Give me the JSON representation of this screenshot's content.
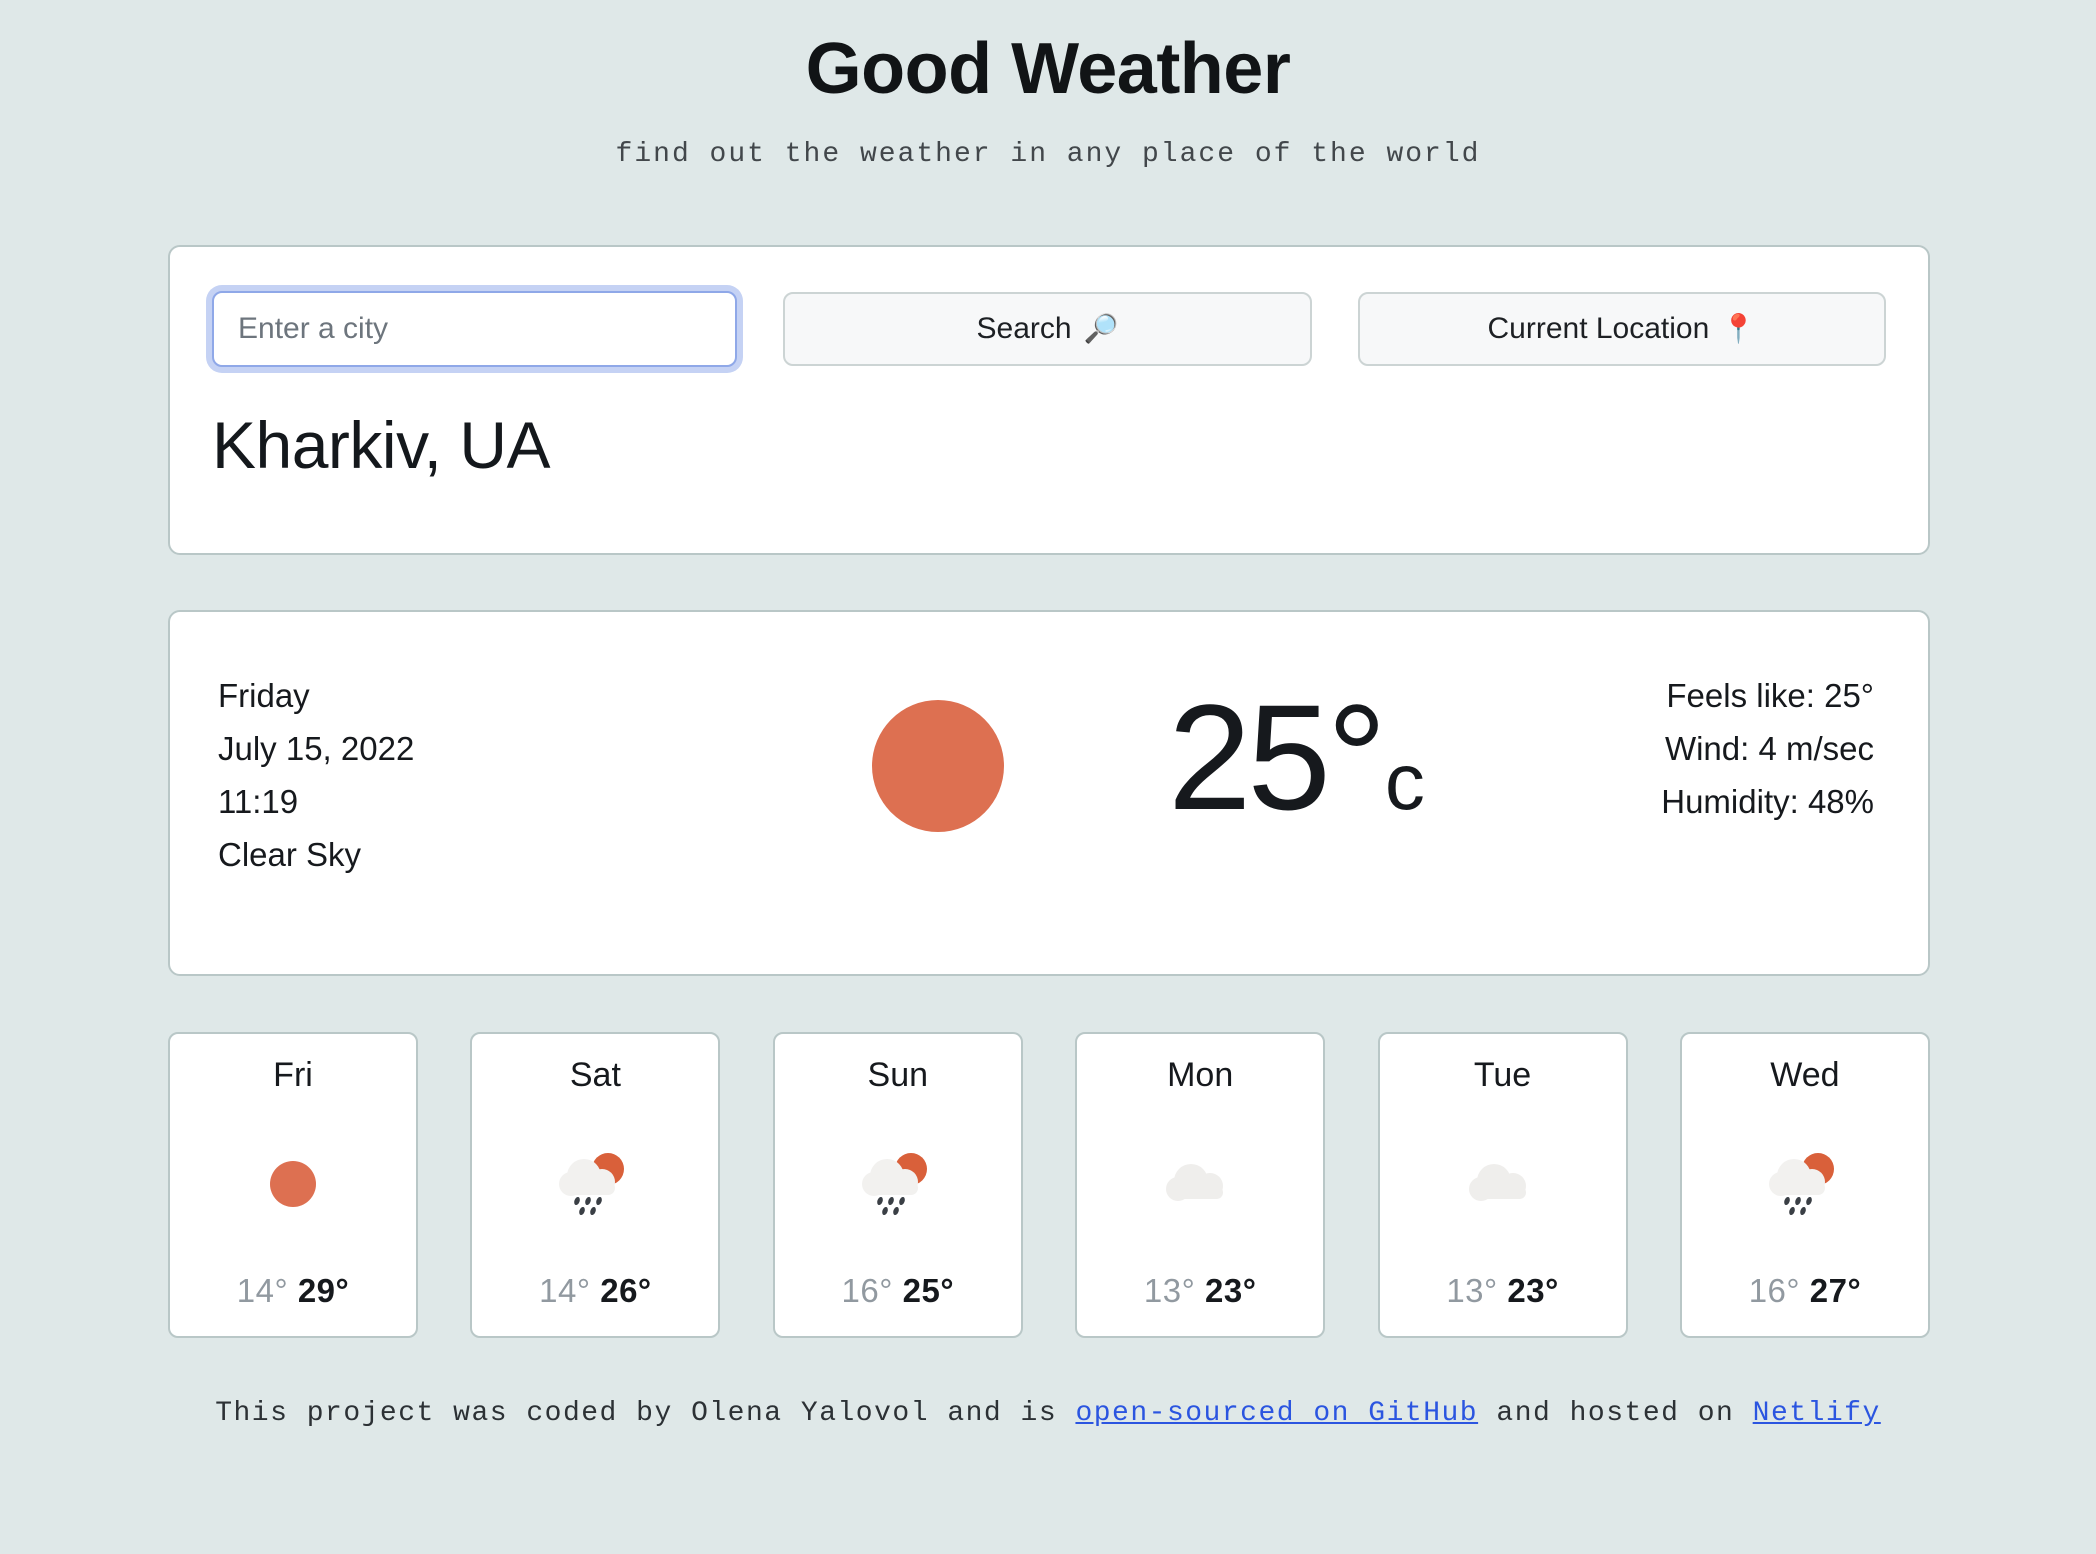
{
  "header": {
    "title": "Good Weather",
    "subtitle": "find out the weather in any place of the world"
  },
  "search": {
    "input_value": "",
    "placeholder": "Enter a city",
    "search_label": "Search",
    "search_icon": "search-icon",
    "search_emoji": "🔎",
    "location_label": "Current Location",
    "location_icon": "map-pin-icon",
    "location_emoji": "📍",
    "city_name": "Kharkiv, UA"
  },
  "current": {
    "day": "Friday",
    "date": "July 15, 2022",
    "time": "11:19",
    "description": "Clear Sky",
    "icon": "sun-icon",
    "temperature": "25°",
    "unit": "c",
    "feels_like": "Feels like: 25°",
    "wind": "Wind: 4 m/sec",
    "humidity": "Humidity: 48%"
  },
  "forecast": [
    {
      "day": "Fri",
      "icon": "sun-icon",
      "min": "14°",
      "max": "29°"
    },
    {
      "day": "Sat",
      "icon": "sun-rain-cloud-icon",
      "min": "14°",
      "max": "26°"
    },
    {
      "day": "Sun",
      "icon": "sun-rain-cloud-icon",
      "min": "16°",
      "max": "25°"
    },
    {
      "day": "Mon",
      "icon": "cloud-icon",
      "min": "13°",
      "max": "23°"
    },
    {
      "day": "Tue",
      "icon": "cloud-icon",
      "min": "13°",
      "max": "23°"
    },
    {
      "day": "Wed",
      "icon": "sun-rain-cloud-icon",
      "min": "16°",
      "max": "27°"
    }
  ],
  "footer": {
    "text_1": "This project was coded by Olena Yalovol and is ",
    "link_1": "open-sourced on GitHub",
    "text_2": " and hosted on ",
    "link_2": "Netlify"
  },
  "colors": {
    "background": "#dfe8e8",
    "card_border": "#b9c7c7",
    "sun": "#dd7051",
    "link": "#2b55e0",
    "focus_ring": "#c5d2f4"
  }
}
